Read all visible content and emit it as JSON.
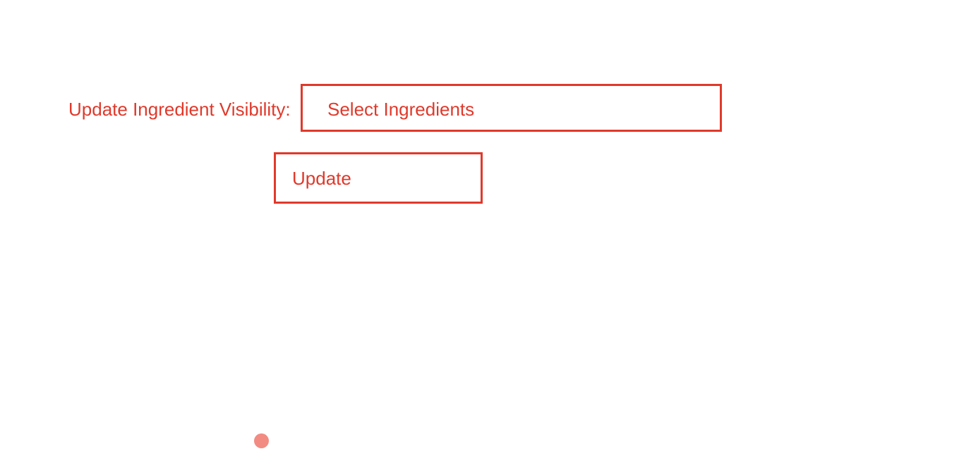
{
  "form": {
    "label": "Update Ingredient Visibility:",
    "select_placeholder": "Select Ingredients",
    "update_label": "Update"
  },
  "colors": {
    "accent": "#e0392b",
    "cursor": "#f28b82",
    "background": "#ffffff"
  },
  "icons": {
    "cursor": "cursor-dot-icon"
  }
}
